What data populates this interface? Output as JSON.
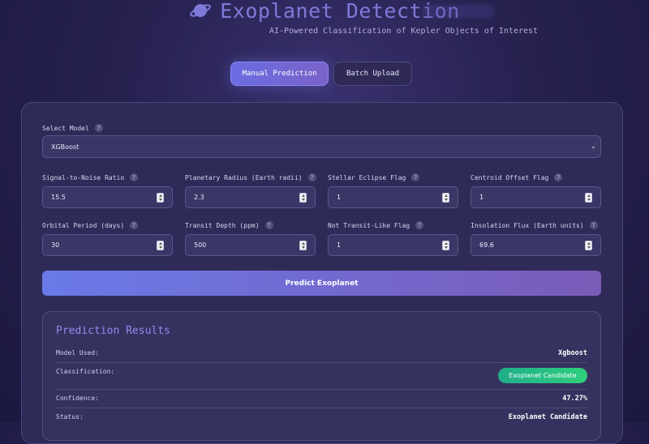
{
  "header": {
    "title": "Exoplanet Detection",
    "subtitle": "AI-Powered Classification of Kepler Objects of Interest"
  },
  "tabs": [
    {
      "label": "Manual Prediction",
      "active": true
    },
    {
      "label": "Batch Upload",
      "active": false
    }
  ],
  "form": {
    "model_label": "Select Model",
    "model_value": "XGBoost",
    "fields": [
      {
        "label": "Signal-to-Noise Ratio",
        "value": "15.5"
      },
      {
        "label": "Planetary Radius (Earth radii)",
        "value": "2.3"
      },
      {
        "label": "Stellar Eclipse Flag",
        "value": "1"
      },
      {
        "label": "Centroid Offset Flag",
        "value": "1"
      },
      {
        "label": "Orbital Period (days)",
        "value": "30"
      },
      {
        "label": "Transit Depth (ppm)",
        "value": "500"
      },
      {
        "label": "Not Transit-Like Flag",
        "value": "1"
      },
      {
        "label": "Insolation Flux (Earth units)",
        "value": "69.6"
      }
    ],
    "help_glyph": "?",
    "predict_label": "Predict Exoplanet"
  },
  "results": {
    "title": "Prediction Results",
    "model_label": "Model Used:",
    "model_value": "Xgboost",
    "classification_label": "Classification:",
    "classification_value": "Exoplanet Candidate",
    "confidence_label": "Confidence:",
    "confidence_value": "47.27%",
    "status_label": "Status:",
    "status_value": "Exoplanet Candidate"
  },
  "colors": {
    "accent": "#7f7ad8",
    "badge": "#2fcf7c"
  }
}
